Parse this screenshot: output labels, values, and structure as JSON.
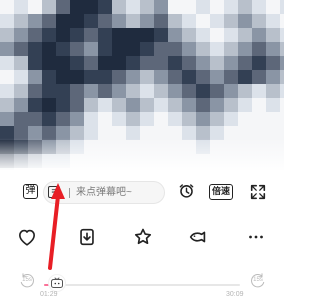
{
  "video": {
    "blur_palette": [
      "#f5f6f8",
      "#dce2ea",
      "#b8c0cb",
      "#8a95a5",
      "#5d6779",
      "#334054",
      "#1f2b3e",
      "#6f8196",
      "#9cabb6",
      "#c6ccd5"
    ]
  },
  "controls": {
    "danmu_toggle_label": "弹",
    "danmu_icon_label": "≡",
    "danmu_placeholder": "来点弹幕吧~",
    "speed_label": "倍速"
  },
  "actions": {
    "like_icon": "heart-icon",
    "download_icon": "download-icon",
    "favorite_icon": "star-icon",
    "share_icon": "fish-icon",
    "more_icon": "more-icon"
  },
  "player": {
    "skip_back_label": "15s",
    "skip_forward_label": "15s",
    "current_time": "01:29",
    "duration": "30:09",
    "progress": 0.05,
    "progress_color": "#fb7299"
  },
  "annotation": {
    "arrow_color": "#e81e25"
  }
}
